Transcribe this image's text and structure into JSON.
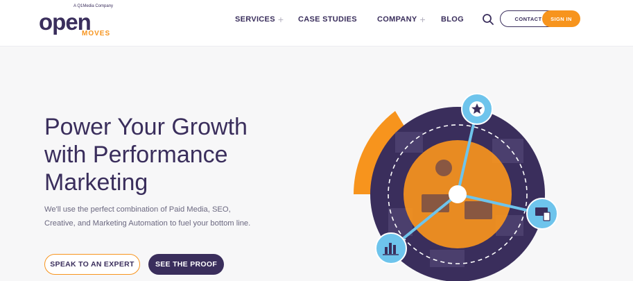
{
  "brand": {
    "tagline": "A Q1Media Company",
    "wordmark": "open",
    "sub": "MOVES",
    "colors": {
      "purple": "#3a2e5c",
      "orange": "#f7941d",
      "blue": "#5ab8e6"
    }
  },
  "nav": {
    "services": "SERVICES",
    "case_studies": "CASE STUDIES",
    "company": "COMPANY",
    "blog": "BLOG",
    "expand_glyph": "+"
  },
  "header": {
    "search_icon": "search-icon",
    "contact_label": "CONTACT",
    "signin_label": "SIGN IN"
  },
  "hero": {
    "headline_lines": [
      "Power Your Growth",
      "with Performance",
      "Marketing"
    ],
    "subtext_lines": [
      "We'll use the perfect combination of Paid Media, SEO,",
      "Creative, and Marketing Automation to fuel your bottom line."
    ],
    "cta_primary": "SPEAK TO AN EXPERT",
    "cta_secondary": "SEE THE PROOF",
    "graphic_icons": [
      "star-icon",
      "devices-icon",
      "bar-chart-icon"
    ]
  }
}
